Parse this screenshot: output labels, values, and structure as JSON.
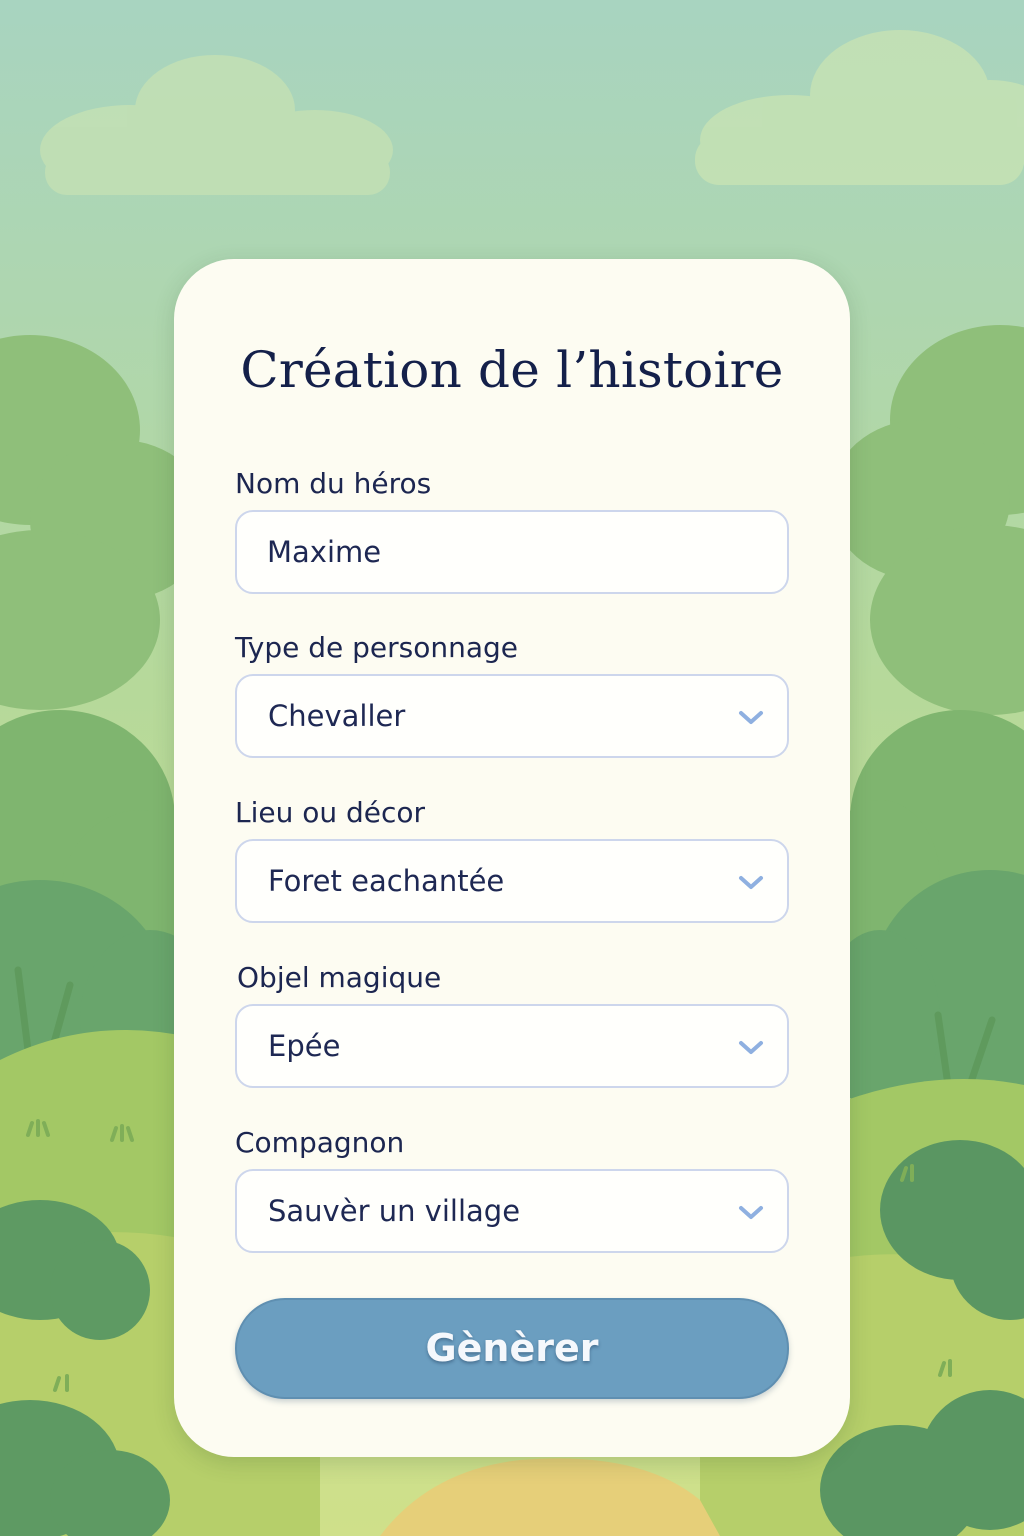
{
  "form": {
    "title": "Création de l’histoire",
    "fields": [
      {
        "label": "Nom du héros",
        "value": "Maxime",
        "type": "text"
      },
      {
        "label": "Type de personnage",
        "value": "Chevaller",
        "type": "select"
      },
      {
        "label": "Lieu ou décor",
        "value": "Foret eachantée",
        "type": "select"
      },
      {
        "label": "Objel magique",
        "value": "Epée",
        "type": "select"
      },
      {
        "label": "Compagnon",
        "value": "Sauvèr un village",
        "type": "select"
      }
    ],
    "submit_label": "Gènèrer"
  },
  "icons": {
    "dropdown": "chevron-down-icon"
  },
  "colors": {
    "card_background": "#fdfcf2",
    "title_text": "#14204a",
    "field_border": "#cdd6ec",
    "chevron": "#8fb0e0",
    "button_background": "#6b9ec0",
    "sky": "#a9d3bd",
    "hills": "#9cc46a",
    "path": "#e8cf78"
  }
}
